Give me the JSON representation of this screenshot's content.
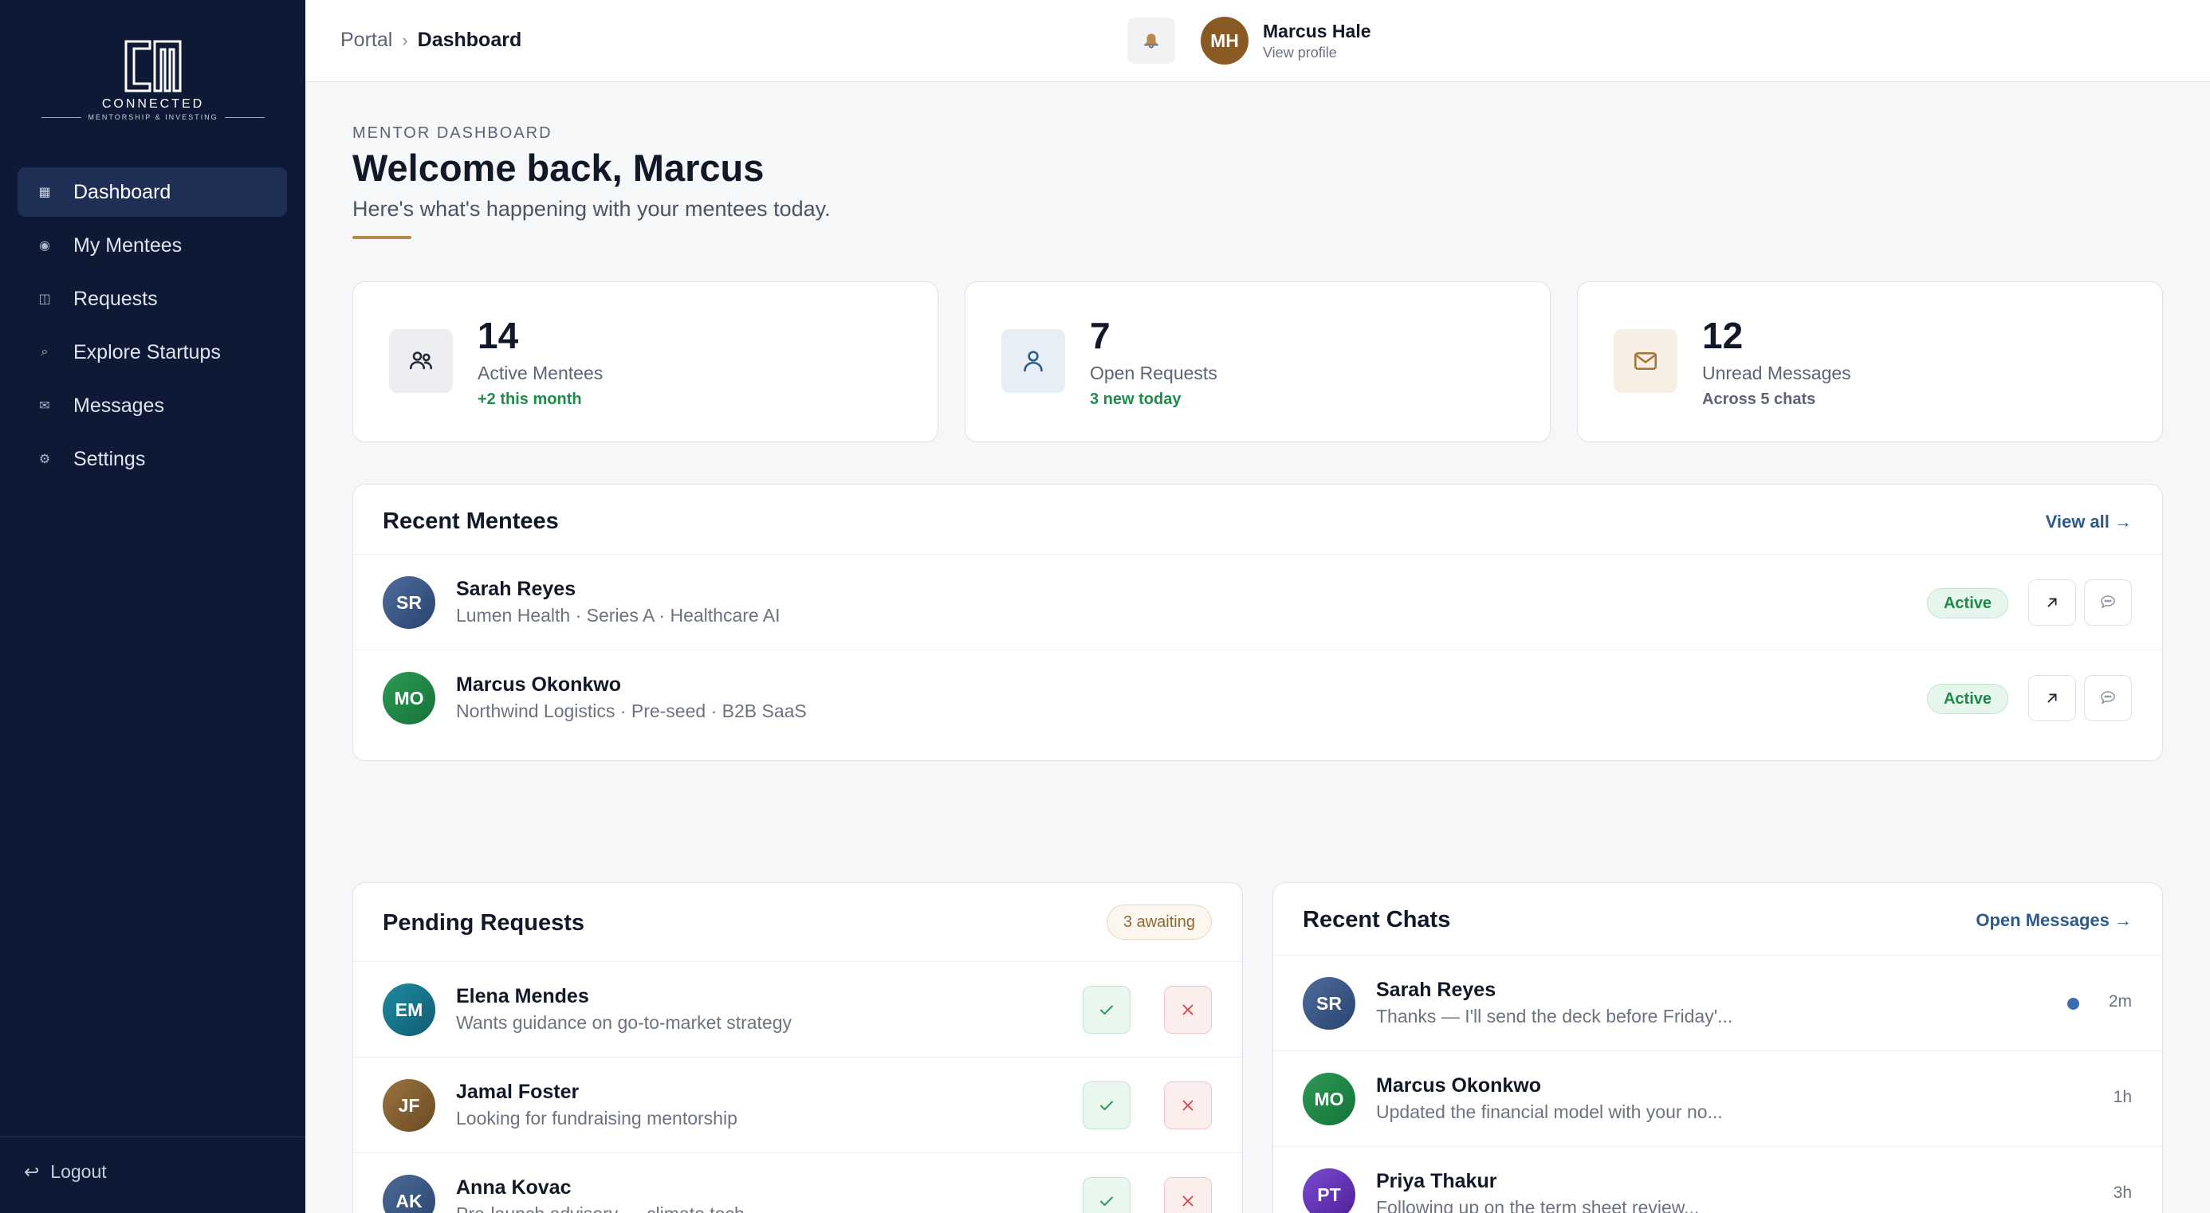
{
  "brand": {
    "name": "CONNECTED",
    "tagline": "MENTORSHIP & INVESTING"
  },
  "sidebar": {
    "items": [
      {
        "label": "Dashboard",
        "icon": "dashboard-icon",
        "active": true
      },
      {
        "label": "My Mentees",
        "icon": "mentees-icon"
      },
      {
        "label": "Requests",
        "icon": "requests-icon"
      },
      {
        "label": "Explore Startups",
        "icon": "explore-icon"
      },
      {
        "label": "Messages",
        "icon": "messages-icon"
      },
      {
        "label": "Settings",
        "icon": "settings-icon"
      }
    ],
    "logout": "Logout"
  },
  "topbar": {
    "breadcrumb": {
      "root": "Portal",
      "separator": "›",
      "current": "Dashboard"
    },
    "user": {
      "initials": "MH",
      "name": "Marcus Hale",
      "link": "View profile"
    }
  },
  "header": {
    "eyebrow": "MENTOR DASHBOARD",
    "title": "Welcome back, Marcus",
    "subtitle": "Here's what's happening with your mentees today."
  },
  "stats": [
    {
      "value": "14",
      "label": "Active Mentees",
      "note": "+2 this month",
      "icon": "users-icon"
    },
    {
      "value": "7",
      "label": "Open Requests",
      "note": "3 new today",
      "icon": "user-icon"
    },
    {
      "value": "12",
      "label": "Unread Messages",
      "note": "Across 5 chats",
      "icon": "mail-icon"
    }
  ],
  "recent_mentees": {
    "title": "Recent Mentees",
    "link": "View all →",
    "rows": [
      {
        "initials": "SR",
        "name": "Sarah Reyes",
        "sub": "Lumen Health · Series A · Healthcare AI",
        "status": "Active"
      },
      {
        "initials": "MO",
        "name": "Marcus Okonkwo",
        "sub": "Northwind Logistics · Pre-seed · B2B SaaS",
        "status": "Active"
      }
    ]
  },
  "pending_requests": {
    "title": "Pending Requests",
    "badge": "3 awaiting",
    "rows": [
      {
        "initials": "EM",
        "name": "Elena Mendes",
        "sub": "Wants guidance on go-to-market strategy"
      },
      {
        "initials": "JF",
        "name": "Jamal Foster",
        "sub": "Looking for fundraising mentorship"
      },
      {
        "initials": "AK",
        "name": "Anna Kovac",
        "sub": "Pre-launch advisory — climate tech"
      }
    ]
  },
  "recent_chats": {
    "title": "Recent Chats",
    "link": "Open Messages →",
    "rows": [
      {
        "initials": "SR",
        "name": "Sarah Reyes",
        "preview": "Thanks — I'll send the deck before Friday'...",
        "time": "2m",
        "unread": true
      },
      {
        "initials": "MO",
        "name": "Marcus Okonkwo",
        "preview": "Updated the financial model with your no...",
        "time": "1h"
      },
      {
        "initials": "PT",
        "name": "Priya Thakur",
        "preview": "Following up on the term sheet review...",
        "time": "3h"
      }
    ]
  },
  "colors": {
    "sidebar_bg": "#0e1a35",
    "accent_gold": "#b7884a",
    "link_blue": "#2c5a8a",
    "success_green": "#1f8a4c",
    "danger_red": "#d64545"
  }
}
